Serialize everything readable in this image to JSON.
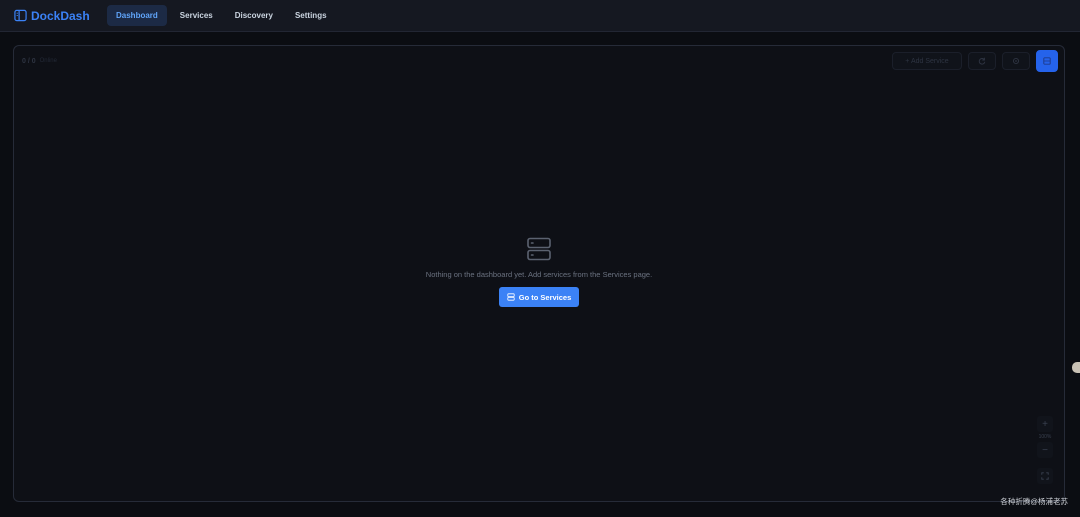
{
  "app": {
    "name": "DockDash",
    "accent": "#3b82f6"
  },
  "nav": {
    "items": [
      {
        "label": "Dashboard",
        "active": true
      },
      {
        "label": "Services"
      },
      {
        "label": "Discovery"
      },
      {
        "label": "Settings"
      }
    ]
  },
  "toolbar": {
    "count": "0 / 0",
    "count_label": "Online",
    "add_label": "+ Add Service",
    "refresh_icon": "refresh-icon",
    "settings_icon": "gear-icon",
    "layout_icon": "grid-icon"
  },
  "empty_state": {
    "icon": "server-stack-icon",
    "message": "Nothing on the dashboard yet. Add services from the Services page.",
    "cta_label": "Go to Services"
  },
  "zoom": {
    "in": "+",
    "level": "100%",
    "out": "−",
    "fit_icon": "fullscreen-icon"
  },
  "watermark": "各种折腾@杨浦老苏"
}
